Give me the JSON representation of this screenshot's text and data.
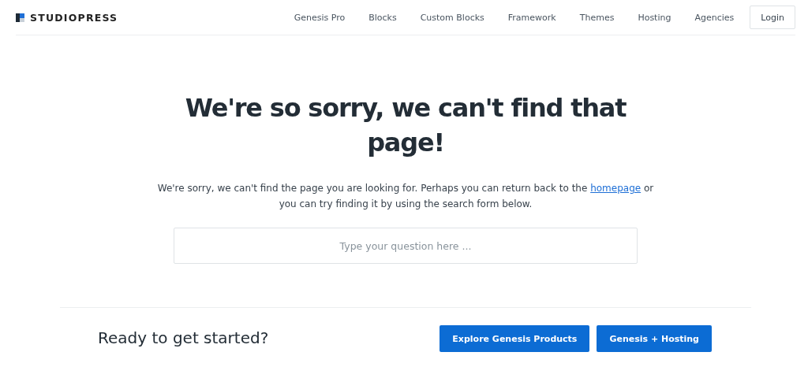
{
  "header": {
    "logo": "STUDIOPRESS",
    "nav": [
      "Genesis Pro",
      "Blocks",
      "Custom Blocks",
      "Framework",
      "Themes",
      "Hosting",
      "Agencies"
    ],
    "login": "Login"
  },
  "main": {
    "title": "We're so sorry, we can't find that page!",
    "message_before": "We're sorry, we can't find the page you are looking for. Perhaps you can return back to the ",
    "link": "homepage",
    "message_after": " or you can try finding it by using the search form below.",
    "search": {
      "placeholder": "Type your question here ..."
    }
  },
  "cta": {
    "heading": "Ready to get started?",
    "buttons": [
      "Explore Genesis Products",
      "Genesis + Hosting"
    ]
  }
}
